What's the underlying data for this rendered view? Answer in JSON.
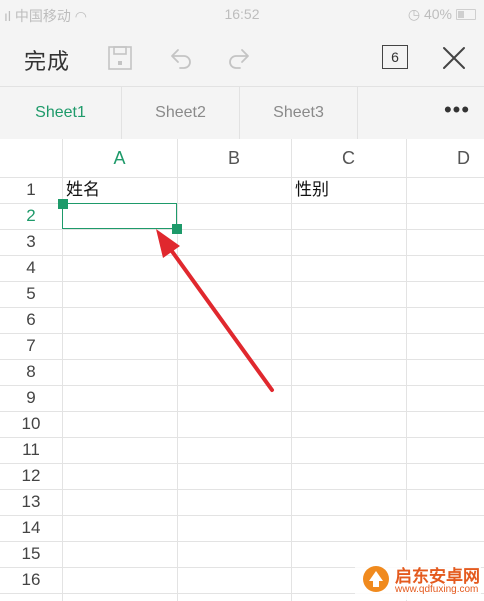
{
  "status_bar": {
    "carrier": "中国移动",
    "time": "16:52",
    "battery": "40%"
  },
  "toolbar": {
    "done_label": "完成",
    "tab_count": "6"
  },
  "sheets": {
    "tabs": [
      "Sheet1",
      "Sheet2",
      "Sheet3"
    ],
    "active": "Sheet1",
    "more_label": "•••"
  },
  "grid": {
    "columns": [
      "A",
      "B",
      "C",
      "D"
    ],
    "rows": [
      "1",
      "2",
      "3",
      "4",
      "5",
      "6",
      "7",
      "8",
      "9",
      "10",
      "11",
      "12",
      "13",
      "14",
      "15",
      "16"
    ],
    "active_column": "A",
    "active_row": "2",
    "cells": {
      "A1": "姓名",
      "C1": "性别"
    }
  },
  "watermark": {
    "name": "启东安卓网",
    "url": "www.qdfuxing.com"
  },
  "colors": {
    "accent": "#1e9a6a",
    "arrow": "#e0282e"
  }
}
